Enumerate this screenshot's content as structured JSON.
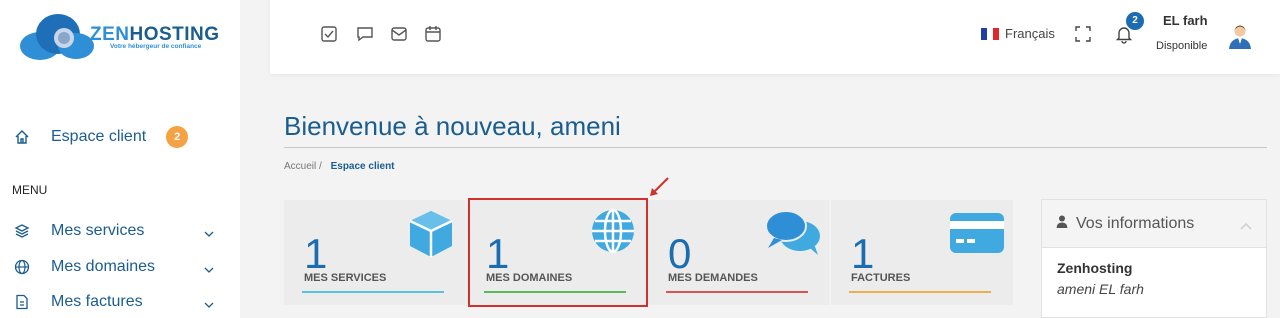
{
  "logo": {
    "brand_prefix": "ZEN",
    "brand_suffix": "HOSTING",
    "tagline": "Votre hébergeur de confiance"
  },
  "sidebar": {
    "home": {
      "label": "Espace client",
      "badge": "2"
    },
    "menu_title": "MENU",
    "items": [
      {
        "label": "Mes services",
        "icon": "layers-icon"
      },
      {
        "label": "Mes domaines",
        "icon": "globe-icon"
      },
      {
        "label": "Mes factures",
        "icon": "invoice-icon"
      }
    ]
  },
  "header": {
    "quick_icons": [
      "checkbox-icon",
      "chat-icon",
      "mail-icon",
      "calendar-icon"
    ],
    "language": "Français",
    "notifications_count": "2",
    "user_name": "EL farh",
    "user_status": "Disponible"
  },
  "page": {
    "title": "Bienvenue à nouveau, ameni",
    "breadcrumb": {
      "root": "Accueil",
      "separator": "/",
      "current": "Espace client"
    }
  },
  "stats": [
    {
      "value": "1",
      "label": "MES SERVICES",
      "color": "#5bc0de",
      "icon": "box-icon"
    },
    {
      "value": "1",
      "label": "MES DOMAINES",
      "color": "#5cb85c",
      "icon": "globe-icon"
    },
    {
      "value": "0",
      "label": "MES DEMANDES",
      "color": "#d9534f",
      "icon": "comments-icon"
    },
    {
      "value": "1",
      "label": "FACTURES",
      "color": "#f0ad4e",
      "icon": "credit-card-icon"
    }
  ],
  "info": {
    "title": "Vos informations",
    "company": "Zenhosting",
    "user": "ameni EL farh"
  },
  "colors": {
    "primary": "#1a5d8f",
    "icon_blue": "#3fa9e0",
    "badge_orange": "#f4a243",
    "highlight": "#d0312d"
  }
}
